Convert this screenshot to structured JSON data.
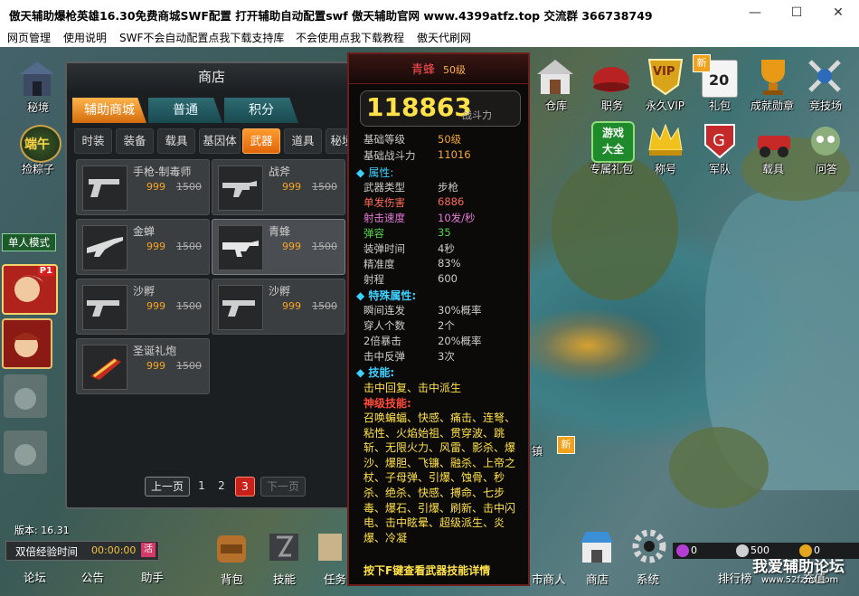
{
  "window": {
    "title": "傲天辅助爆枪英雄16.30免费商城SWF配置  打开辅助自动配置swf 傲天辅助官网 www.4399atfz.top 交流群 366738749",
    "minimize": "—",
    "maximize": "☐",
    "close": "✕"
  },
  "menu": [
    "网页管理",
    "使用说明",
    "SWF不会自动配置点我下载支持库",
    "不会使用点我下载教程",
    "傲天代刷网"
  ],
  "left_panel": {
    "secret": "秘境",
    "zongzi_badge": "端午",
    "zongzi": "捡粽子",
    "single_mode": "单人模式",
    "p1_badge": "P1",
    "version": "版本: 16.31",
    "double_exp": "双倍经验时间",
    "double_exp_time": "00:00:00",
    "double_exp_btn": "活",
    "forum": "论坛",
    "announce": "公告",
    "helper": "助手"
  },
  "right_icons": [
    {
      "label": "仓库"
    },
    {
      "label": "职务"
    },
    {
      "label": "永久VIP",
      "badge": "VIP"
    },
    {
      "label": "礼包",
      "badge": "新",
      "day": "20"
    },
    {
      "label": "成就勋章"
    },
    {
      "label": "竞技场"
    },
    {
      "label": "专属礼包",
      "text": "游戏大全"
    },
    {
      "label": "称号"
    },
    {
      "label": "军队"
    },
    {
      "label": "载具"
    },
    {
      "label": "问答"
    }
  ],
  "map": {
    "town_label": "镇",
    "town_badge": "新"
  },
  "shop": {
    "title": "商店",
    "tabs": [
      "辅助商城",
      "普通",
      "积分"
    ],
    "subtabs": [
      "时装",
      "装备",
      "载具",
      "基因体",
      "武器",
      "道具",
      "秘境"
    ],
    "active_subtab": 4,
    "items": [
      {
        "name": "手枪-制毒师",
        "price": "999",
        "orig": "1500"
      },
      {
        "name": "战斧",
        "price": "999",
        "orig": "1500"
      },
      {
        "name": "金蝉",
        "price": "999",
        "orig": "1500"
      },
      {
        "name": "青蜂",
        "price": "999",
        "orig": "1500"
      },
      {
        "name": "沙孵",
        "price": "999",
        "orig": "1500"
      },
      {
        "name": "沙孵",
        "price": "999",
        "orig": "1500"
      },
      {
        "name": "圣诞礼炮",
        "price": "999",
        "orig": "1500"
      }
    ],
    "pager": {
      "prev": "上一页",
      "pages": [
        "1",
        "2",
        "3"
      ],
      "current": "3",
      "next": "下一页"
    }
  },
  "tooltip": {
    "name": "青蜂",
    "level_tag": "50级",
    "power": "118863",
    "power_label": "战斗力",
    "base": [
      {
        "k": "基础等级",
        "v": "50级"
      },
      {
        "k": "基础战斗力",
        "v": "11016"
      }
    ],
    "attr_title": "属性:",
    "attrs": [
      {
        "k": "武器类型",
        "v": "步枪"
      },
      {
        "k": "单发伤害",
        "v": "6886"
      },
      {
        "k": "射击速度",
        "v": "10发/秒"
      },
      {
        "k": "弹容",
        "v": "35"
      },
      {
        "k": "装弹时间",
        "v": "4秒"
      },
      {
        "k": "精准度",
        "v": "83%"
      },
      {
        "k": "射程",
        "v": "600"
      }
    ],
    "special_title": "特殊属性:",
    "specials": [
      {
        "k": "瞬间连发",
        "v": "30%概率"
      },
      {
        "k": "穿人个数",
        "v": "2个"
      },
      {
        "k": "2倍暴击",
        "v": "20%概率"
      },
      {
        "k": "击中反弹",
        "v": "3次"
      }
    ],
    "skill_title": "技能:",
    "skills": "击中回复、击中派生",
    "god_title": "神级技能:",
    "god_skills": "召唤蝙蝠、快感、痛击、连弩、粘性、火焰始祖、贯穿波、跳斩、无限火力、风雷、影杀、爆沙、爆胆、飞镰、融杀、上帝之杖、子母弹、引爆、蚀骨、秒杀、绝杀、快感、搏命、七步毒、爆石、引爆、刷新、击中闪电、击中眩晕、超级派生、炎爆、冷凝",
    "footer": "按下F键查看武器技能详情"
  },
  "bottom": {
    "items": [
      "背包",
      "技能",
      "任务",
      "市商人",
      "商店",
      "系统"
    ],
    "currency1": "0",
    "currency2": "500",
    "currency3": "0",
    "rank": "排行榜",
    "more": "充值",
    "watermark": "我爱辅助论坛",
    "watermark_url": "www.52fzba.com"
  }
}
